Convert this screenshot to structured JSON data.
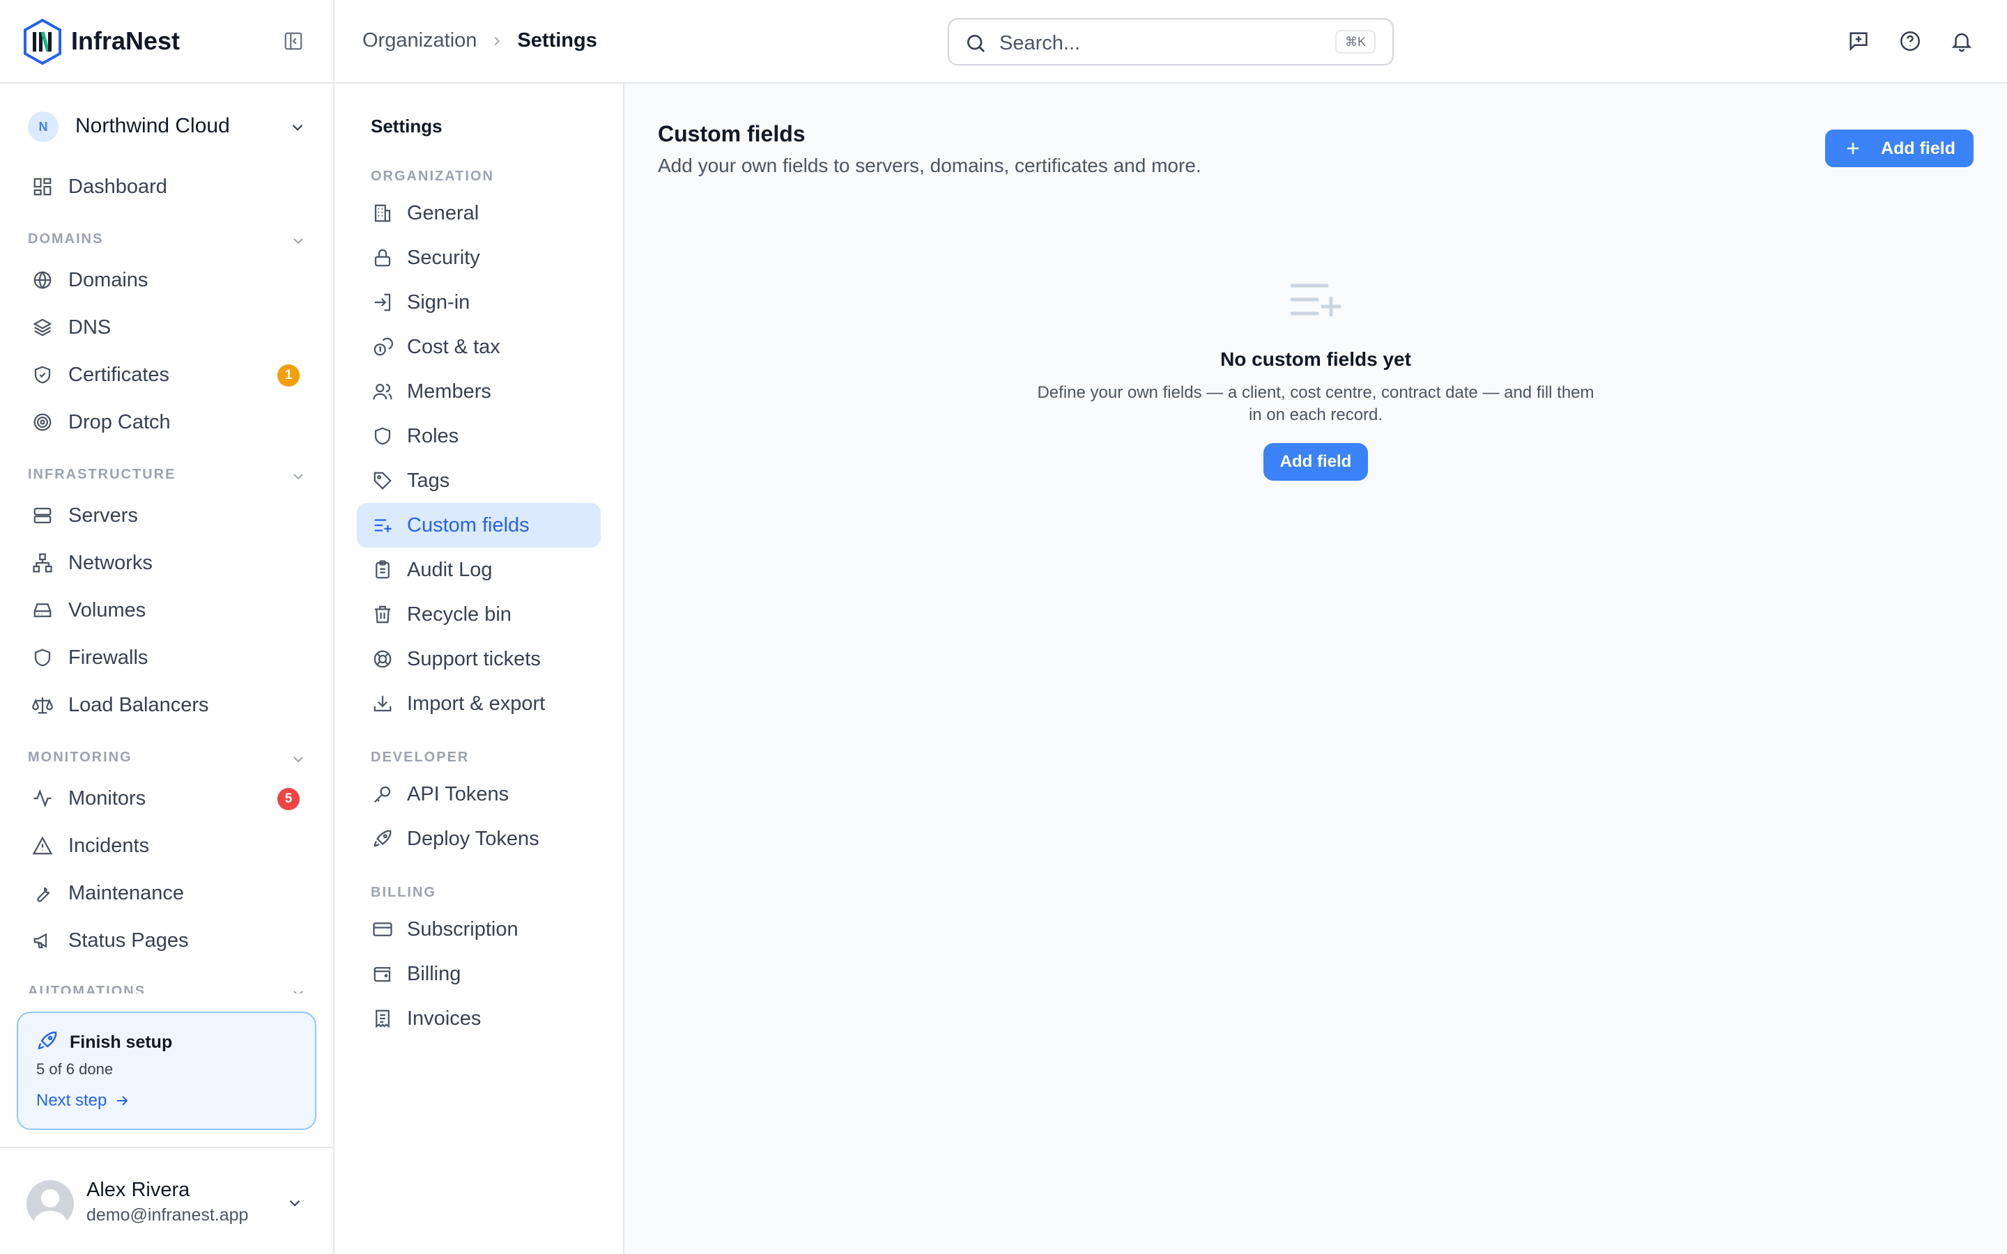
{
  "app": {
    "name": "InfraNest"
  },
  "org": {
    "initial": "N",
    "name": "Northwind Cloud"
  },
  "sidebar": {
    "dashboard": "Dashboard",
    "sections": {
      "domains": "DOMAINS",
      "infrastructure": "INFRASTRUCTURE",
      "monitoring": "MONITORING",
      "automations": "AUTOMATIONS"
    },
    "items": {
      "domains": "Domains",
      "dns": "DNS",
      "certificates": "Certificates",
      "drop_catch": "Drop Catch",
      "servers": "Servers",
      "networks": "Networks",
      "volumes": "Volumes",
      "firewalls": "Firewalls",
      "load_balancers": "Load Balancers",
      "monitors": "Monitors",
      "incidents": "Incidents",
      "maintenance": "Maintenance",
      "status_pages": "Status Pages"
    },
    "badges": {
      "certificates": "1",
      "monitors": "5"
    },
    "badge_colors": {
      "certificates": "#f59e0b",
      "monitors": "#ef4444"
    }
  },
  "setup": {
    "title": "Finish setup",
    "progress_text": "5 of 6 done",
    "next_label": "Next step"
  },
  "user": {
    "name": "Alex Rivera",
    "email": "demo@infranest.app"
  },
  "topbar": {
    "breadcrumb": [
      "Organization",
      "Settings"
    ],
    "search_placeholder": "Search...",
    "search_shortcut": "⌘K"
  },
  "settings_nav": {
    "title": "Settings",
    "sections": {
      "organization": "ORGANIZATION",
      "developer": "DEVELOPER",
      "billing": "BILLING"
    },
    "items": {
      "general": "General",
      "security": "Security",
      "sign_in": "Sign-in",
      "cost_tax": "Cost & tax",
      "members": "Members",
      "roles": "Roles",
      "tags": "Tags",
      "custom_fields": "Custom fields",
      "audit_log": "Audit Log",
      "recycle_bin": "Recycle bin",
      "support_tickets": "Support tickets",
      "import_export": "Import & export",
      "api_tokens": "API Tokens",
      "deploy_tokens": "Deploy Tokens",
      "subscription": "Subscription",
      "billing": "Billing",
      "invoices": "Invoices"
    },
    "active": "custom_fields"
  },
  "main": {
    "title": "Custom fields",
    "subtitle": "Add your own fields to servers, domains, certificates and more.",
    "add_button": "Add field",
    "empty": {
      "title": "No custom fields yet",
      "description": "Define your own fields — a client, cost centre, contract date — and fill them in on each record.",
      "button": "Add field"
    }
  },
  "colors": {
    "accent": "#3b82f6",
    "active_bg": "#dbeafe",
    "active_text": "#2563eb"
  }
}
